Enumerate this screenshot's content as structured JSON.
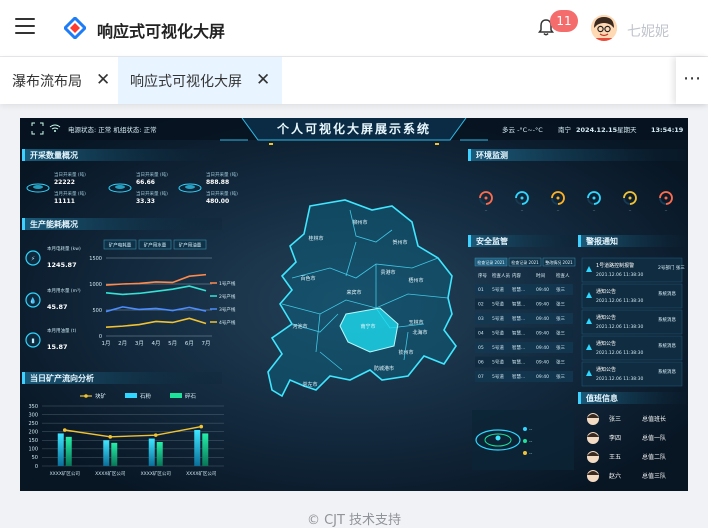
{
  "header": {
    "title": "响应式可视化大屏",
    "notifications": "11",
    "user": "七妮妮"
  },
  "tabs": [
    {
      "label": "瀑布流布局"
    },
    {
      "label": "响应式可视化大屏",
      "active": true
    }
  ],
  "dashboard": {
    "title": "个人可视化大屏展示系统",
    "status_left": "电源状态: 正常  机组状态: 正常",
    "weather": "多云 -°C~-°C",
    "city": "南宁",
    "date": "2024.12.15",
    "weekday": "星期天",
    "time": "13:54:19",
    "panels": {
      "mining": "开采数量概况",
      "energy": "生产能耗概况",
      "flow": "当日矿产流向分析",
      "env": "环境监测",
      "safety": "安全监管",
      "alarm": "警报通知",
      "duty": "值班信息"
    },
    "mining_items": [
      {
        "l1": "当日开采量 (吨)",
        "v1": "22222",
        "l2": "当月开采量 (吨)",
        "v2": "11111"
      },
      {
        "l1": "当日开采量 (吨)",
        "v1": "66.66",
        "l2": "当日开采量 (吨)",
        "v2": "33.33"
      },
      {
        "l1": "当日开采量 (吨)",
        "v1": "888.88",
        "l2": "当日开采量 (吨)",
        "v2": "480.00"
      }
    ],
    "energy_items": [
      {
        "label": "本月电耗量 (kw)",
        "value": "1245.87"
      },
      {
        "label": "本月用水量 (m³)",
        "value": "45.87"
      },
      {
        "label": "本月用油量 (t)",
        "value": "15.87"
      }
    ],
    "energy_tabs": [
      "矿产电耗量",
      "矿产用水量",
      "矿产用油量"
    ],
    "legend_flow": [
      "块矿",
      "石粉",
      "碎石"
    ],
    "map_cities": [
      "河池市",
      "柳州市",
      "桂林市",
      "贺州市",
      "来宾市",
      "梧州市",
      "贵港市",
      "百色市",
      "南宁市",
      "玉林市",
      "钦州市",
      "防城港市",
      "北海市",
      "崇左市"
    ],
    "safety_tabs": [
      "检查记录 2021",
      "检查记录 2021",
      "整改情况 2021"
    ],
    "safety_headers": [
      "序号",
      "检查人员",
      "内容",
      "时间",
      "检查人"
    ],
    "safety_rows": [
      [
        "01",
        "5号道",
        "智慧...",
        "09:40",
        "张三"
      ],
      [
        "02",
        "5号道",
        "智慧...",
        "09:40",
        "张三"
      ],
      [
        "03",
        "5号道",
        "智慧...",
        "09:40",
        "张三"
      ],
      [
        "04",
        "5号道",
        "智慧...",
        "09:40",
        "张三"
      ],
      [
        "05",
        "5号道",
        "智慧...",
        "09:40",
        "张三"
      ],
      [
        "06",
        "5号道",
        "智慧...",
        "09:40",
        "张三"
      ],
      [
        "07",
        "5号道",
        "智慧...",
        "09:40",
        "张三"
      ]
    ],
    "alarms": [
      {
        "title": "1号道路控制报警",
        "time": "2021.12.06 11:38:30",
        "tag": "2号部门 张三"
      },
      {
        "title": "通知公告",
        "time": "2021.12.06 11:38:30",
        "tag": "系统消息"
      },
      {
        "title": "通知公告",
        "time": "2021.12.06 11:38:30",
        "tag": "系统消息"
      },
      {
        "title": "通知公告",
        "time": "2021.12.06 11:38:30",
        "tag": "系统消息"
      },
      {
        "title": "通知公告",
        "time": "2021.12.06 11:38:30",
        "tag": "系统消息"
      }
    ],
    "duty": [
      {
        "name": "张三",
        "role": "总值班长"
      },
      {
        "name": "李四",
        "role": "总值一队"
      },
      {
        "name": "王五",
        "role": "总值二队"
      },
      {
        "name": "赵六",
        "role": "总值三队"
      }
    ],
    "colors": {
      "accent": "#3fd0ff",
      "map": "#1aa6c9",
      "highlight": "#4ef0ff"
    }
  },
  "footer": "© CJT 技术支持",
  "chart_data": [
    {
      "type": "line",
      "title": "",
      "categories": [
        "1月",
        "2月",
        "3月",
        "4月",
        "5月",
        "6月",
        "7月"
      ],
      "ylim": [
        0,
        1500
      ],
      "yticks": [
        0,
        500,
        1000,
        1500
      ],
      "series": [
        {
          "name": "1号产线",
          "color": "#ff8a4c",
          "values": [
            980,
            1000,
            1010,
            1040,
            1030,
            1150,
            1180
          ]
        },
        {
          "name": "2号产线",
          "color": "#34e3d6",
          "values": [
            830,
            800,
            820,
            860,
            900,
            960,
            870
          ]
        },
        {
          "name": "3号产线",
          "color": "#4b8cff",
          "values": [
            470,
            560,
            510,
            530,
            490,
            550,
            480
          ]
        },
        {
          "name": "4号产线",
          "color": "#f1c232",
          "values": [
            170,
            190,
            220,
            280,
            260,
            340,
            240
          ]
        }
      ]
    },
    {
      "type": "bar",
      "title": "",
      "categories": [
        "XXXX矿区公司",
        "XXXX矿区公司",
        "XXXX矿区公司",
        "XXXX矿区公司"
      ],
      "ylim": [
        0,
        350
      ],
      "yticks": [
        0,
        50,
        100,
        150,
        200,
        250,
        300,
        350
      ],
      "series": [
        {
          "name": "块矿",
          "color": "#f1c232",
          "type": "line",
          "values": [
            210,
            170,
            180,
            230
          ]
        },
        {
          "name": "石粉",
          "color": "#2fd6ff",
          "values": [
            190,
            150,
            160,
            210
          ]
        },
        {
          "name": "碎石",
          "color": "#1ce29a",
          "values": [
            170,
            135,
            140,
            190
          ]
        }
      ]
    }
  ]
}
